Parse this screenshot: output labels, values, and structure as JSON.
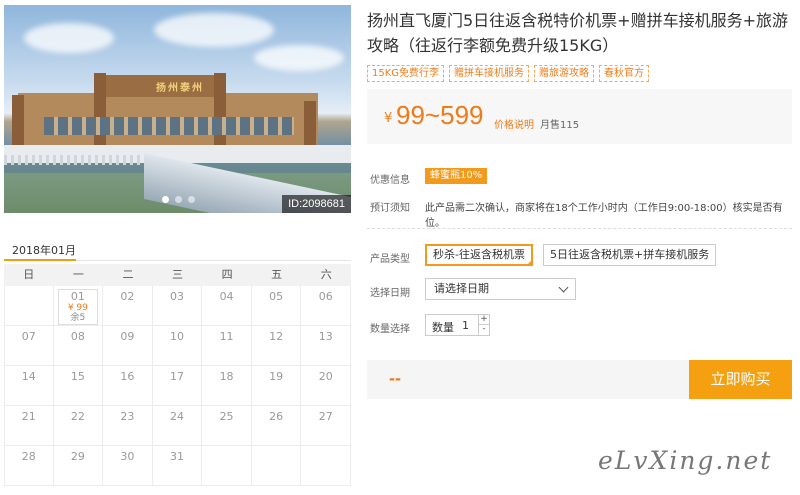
{
  "hero": {
    "sign_text": "扬州泰州",
    "image_id": "ID:2098681",
    "slide_count": 3,
    "active_slide": 1
  },
  "product": {
    "title": "扬州直飞厦门5日往返含税特价机票+赠拼车接机服务+旅游攻略（往返行李额免费升级15KG）",
    "tags": [
      "15KG免费行李",
      "赠拼车接机服务",
      "赠旅游攻略",
      "春秋官方"
    ]
  },
  "price": {
    "currency": "¥",
    "range": "99~599",
    "explain_label": "价格说明",
    "sold_label": "月售115"
  },
  "info": {
    "discount_label": "优惠信息",
    "discount_badge": "蜂蜜瓶10%",
    "notice_label": "预订须知",
    "notice_text": "此产品需二次确认，商家将在18个工作小时内（工作日9:00-18:00）核实是否有位。"
  },
  "options": {
    "type_label": "产品类型",
    "types": [
      "秒杀-往返含税机票",
      "5日往返含税机票+拼车接机服务"
    ],
    "selected_type": 0,
    "date_label": "选择日期",
    "date_placeholder": "请选择日期",
    "qty_label": "数量选择",
    "qty_field_label": "数量",
    "qty_value": "1",
    "qty_plus": "+",
    "qty_minus": "-"
  },
  "buy": {
    "total": "--",
    "button_label": "立即购买"
  },
  "calendar": {
    "month": "2018年01月",
    "weekdays": [
      "日",
      "一",
      "二",
      "三",
      "四",
      "五",
      "六"
    ],
    "first_weekday": 1,
    "days": 31,
    "highlight": {
      "day": "01",
      "price": "¥ 99",
      "stock": "余5"
    }
  },
  "watermark": "eLvXing.net",
  "colors": {
    "accent": "#f39a1d",
    "price": "#ef7a1a",
    "buy_button": "#f5a011"
  }
}
